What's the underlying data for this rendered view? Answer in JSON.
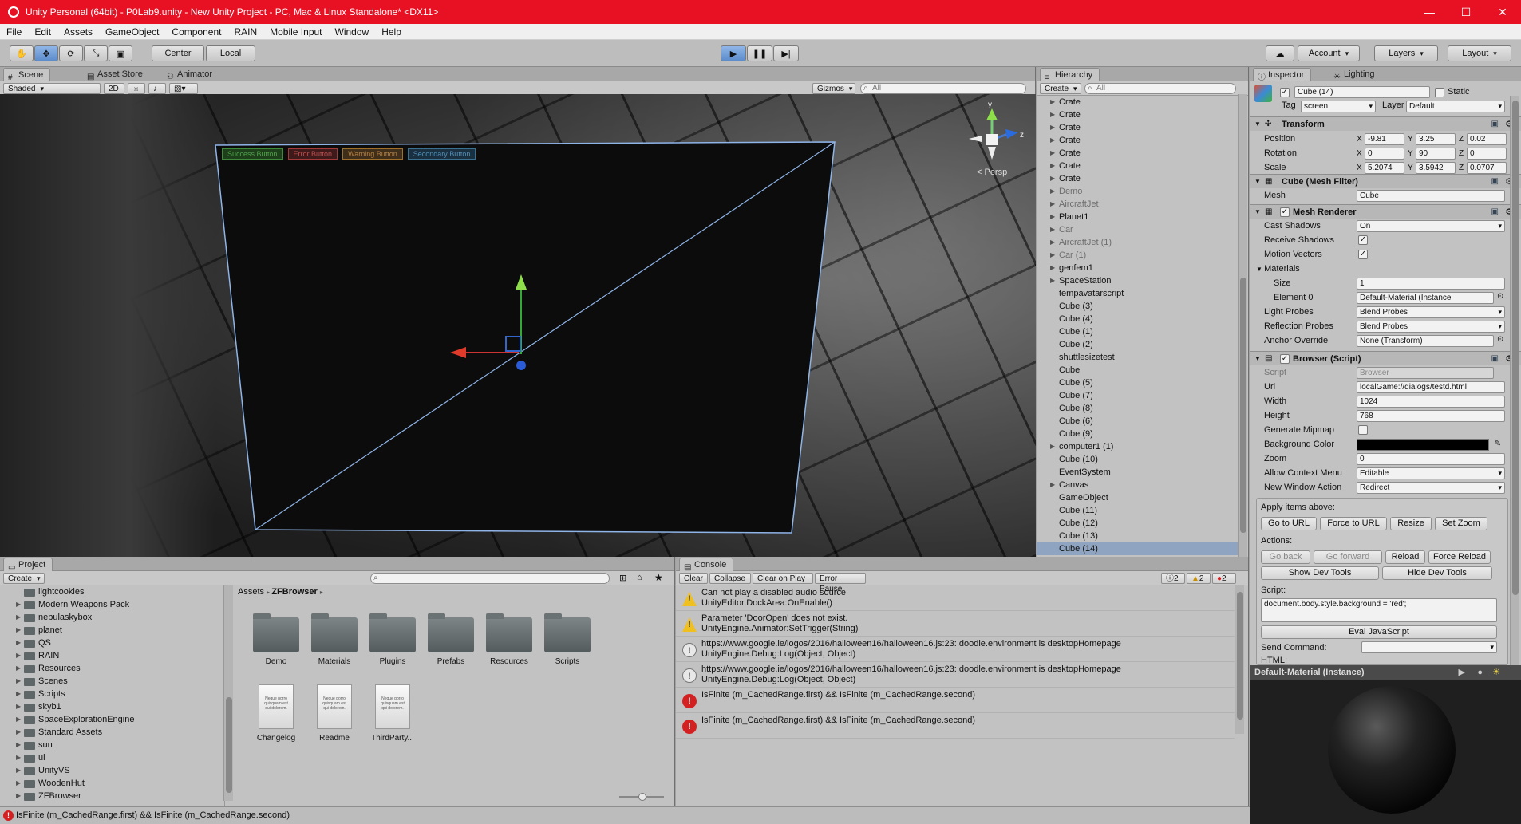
{
  "window": {
    "title": "Unity Personal (64bit) - P0Lab9.unity - New Unity Project - PC, Mac & Linux Standalone* <DX11>",
    "minimize": "—",
    "maximize": "☐",
    "close": "✕"
  },
  "menu": [
    "File",
    "Edit",
    "Assets",
    "GameObject",
    "Component",
    "RAIN",
    "Mobile Input",
    "Window",
    "Help"
  ],
  "toolbar": {
    "tools": [
      "✋",
      "✥",
      "⟳",
      "⤡",
      "▣"
    ],
    "center": "Center",
    "local": "Local",
    "play": "▶",
    "pause": "❚❚",
    "step": "▶|",
    "cloud": "☁",
    "account": "Account",
    "layers": "Layers",
    "layout": "Layout"
  },
  "scene": {
    "tabs": [
      "Scene",
      "Asset Store",
      "Animator"
    ],
    "shading": "Shaded",
    "mode2d": "2D",
    "gizmos": "Gizmos",
    "search_placeholder": "All",
    "buttons": [
      "Success Button",
      "Error Button",
      "Warning Button",
      "Secondary Button"
    ],
    "button_colors": [
      "#3f8a3a",
      "#a33a3a",
      "#a0702a",
      "#3a7090"
    ],
    "persp": "< Persp",
    "axis": {
      "y": "y",
      "z": "z"
    }
  },
  "hierarchy": {
    "tab": "Hierarchy",
    "create": "Create",
    "search_placeholder": "All",
    "items": [
      {
        "label": "Crate",
        "arrow": true,
        "dim": false
      },
      {
        "label": "Crate",
        "arrow": true,
        "dim": false
      },
      {
        "label": "Crate",
        "arrow": true,
        "dim": false
      },
      {
        "label": "Crate",
        "arrow": true,
        "dim": false
      },
      {
        "label": "Crate",
        "arrow": true,
        "dim": false
      },
      {
        "label": "Crate",
        "arrow": true,
        "dim": false
      },
      {
        "label": "Crate",
        "arrow": true,
        "dim": false
      },
      {
        "label": "Demo",
        "arrow": true,
        "dim": true
      },
      {
        "label": "AircraftJet",
        "arrow": true,
        "dim": true
      },
      {
        "label": "Planet1",
        "arrow": true,
        "dim": false
      },
      {
        "label": "Car",
        "arrow": true,
        "dim": true
      },
      {
        "label": "AircraftJet (1)",
        "arrow": true,
        "dim": true
      },
      {
        "label": "Car (1)",
        "arrow": true,
        "dim": true
      },
      {
        "label": "genfem1",
        "arrow": true,
        "dim": false
      },
      {
        "label": "SpaceStation",
        "arrow": true,
        "dim": false
      },
      {
        "label": "tempavatarscript",
        "arrow": false,
        "dim": false
      },
      {
        "label": "Cube (3)",
        "arrow": false,
        "dim": false
      },
      {
        "label": "Cube (4)",
        "arrow": false,
        "dim": false
      },
      {
        "label": "Cube (1)",
        "arrow": false,
        "dim": false
      },
      {
        "label": "Cube (2)",
        "arrow": false,
        "dim": false
      },
      {
        "label": "shuttlesizetest",
        "arrow": false,
        "dim": false
      },
      {
        "label": "Cube",
        "arrow": false,
        "dim": false
      },
      {
        "label": "Cube (5)",
        "arrow": false,
        "dim": false
      },
      {
        "label": "Cube (7)",
        "arrow": false,
        "dim": false
      },
      {
        "label": "Cube (8)",
        "arrow": false,
        "dim": false
      },
      {
        "label": "Cube (6)",
        "arrow": false,
        "dim": false
      },
      {
        "label": "Cube (9)",
        "arrow": false,
        "dim": false
      },
      {
        "label": "computer1 (1)",
        "arrow": true,
        "dim": false
      },
      {
        "label": "Cube (10)",
        "arrow": false,
        "dim": false
      },
      {
        "label": "EventSystem",
        "arrow": false,
        "dim": false
      },
      {
        "label": "Canvas",
        "arrow": true,
        "dim": false
      },
      {
        "label": "GameObject",
        "arrow": false,
        "dim": false
      },
      {
        "label": "Cube (11)",
        "arrow": false,
        "dim": false
      },
      {
        "label": "Cube (12)",
        "arrow": false,
        "dim": false
      },
      {
        "label": "Cube (13)",
        "arrow": false,
        "dim": false
      },
      {
        "label": "Cube (14)",
        "arrow": false,
        "dim": false,
        "selected": true
      }
    ]
  },
  "inspector": {
    "tabs": [
      "Inspector",
      "Lighting"
    ],
    "object_name": "Cube (14)",
    "static": "Static",
    "tag_label": "Tag",
    "tag": "screen",
    "layer_label": "Layer",
    "layer": "Default",
    "transform": {
      "title": "Transform",
      "position": {
        "label": "Position",
        "x": "-9.81",
        "y": "3.25",
        "z": "0.02"
      },
      "rotation": {
        "label": "Rotation",
        "x": "0",
        "y": "90",
        "z": "0"
      },
      "scale": {
        "label": "Scale",
        "x": "5.2074",
        "y": "3.5942",
        "z": "0.0707"
      }
    },
    "mesh_filter": {
      "title": "Cube (Mesh Filter)",
      "mesh_label": "Mesh",
      "mesh": "Cube"
    },
    "mesh_renderer": {
      "title": "Mesh Renderer",
      "cast_shadows_label": "Cast Shadows",
      "cast_shadows": "On",
      "receive_shadows_label": "Receive Shadows",
      "motion_vectors_label": "Motion Vectors",
      "materials_label": "Materials",
      "size_label": "Size",
      "size": "1",
      "element0_label": "Element 0",
      "element0": "Default-Material (Instance",
      "light_probes_label": "Light Probes",
      "light_probes": "Blend Probes",
      "reflection_probes_label": "Reflection Probes",
      "reflection_probes": "Blend Probes",
      "anchor_override_label": "Anchor Override",
      "anchor_override": "None (Transform)"
    },
    "browser": {
      "title": "Browser (Script)",
      "script_label": "Script",
      "script": "Browser",
      "url_label": "Url",
      "url": "localGame://dialogs/testd.html",
      "width_label": "Width",
      "width": "1024",
      "height_label": "Height",
      "height": "768",
      "mipmap_label": "Generate Mipmap",
      "bgcolor_label": "Background Color",
      "bgcolor": "#000000",
      "zoom_label": "Zoom",
      "zoom": "0",
      "context_label": "Allow Context Menu",
      "context": "Editable",
      "newwin_label": "New Window Action",
      "newwin": "Redirect"
    },
    "apply_label": "Apply items above:",
    "apply_buttons": [
      "Go to URL",
      "Force to URL",
      "Resize",
      "Set Zoom"
    ],
    "actions_label": "Actions:",
    "action_buttons": [
      "Go back",
      "Go forward",
      "Reload",
      "Force Reload"
    ],
    "devtools_buttons": [
      "Show Dev Tools",
      "Hide Dev Tools"
    ],
    "script_label2": "Script:",
    "script_text": "document.body.style.background = 'red';",
    "eval_button": "Eval JavaScript",
    "send_command_label": "Send Command:",
    "html_label": "HTML:"
  },
  "preview": {
    "title": "Default-Material (Instance)"
  },
  "project": {
    "tab": "Project",
    "create": "Create",
    "tree": [
      "lightcookies",
      "Modern Weapons Pack",
      "nebulaskybox",
      "planet",
      "QS",
      "RAIN",
      "Resources",
      "Scenes",
      "Scripts",
      "skyb1",
      "SpaceExplorationEngine",
      "Standard Assets",
      "sun",
      "ui",
      "UnityVS",
      "WoodenHut",
      "ZFBrowser"
    ],
    "breadcrumb": [
      "Assets",
      "ZFBrowser"
    ],
    "folders": [
      "Demo",
      "Materials",
      "Plugins",
      "Prefabs",
      "Resources",
      "Scripts"
    ],
    "files": [
      "Changelog",
      "Readme",
      "ThirdParty..."
    ],
    "doc_preview": "Neque porro quisquam est qui dolorem."
  },
  "console": {
    "tab": "Console",
    "buttons": [
      "Clear",
      "Collapse",
      "Clear on Play",
      "Error Pause"
    ],
    "counts": {
      "info": "2",
      "warn": "2",
      "error": "2"
    },
    "lines": [
      {
        "type": "warn",
        "t1": "Can not play a disabled audio source",
        "t2": "UnityEditor.DockArea:OnEnable()"
      },
      {
        "type": "warn",
        "t1": "Parameter 'DoorOpen' does not exist.",
        "t2": "UnityEngine.Animator:SetTrigger(String)"
      },
      {
        "type": "info",
        "t1": "https://www.google.ie/logos/2016/halloween16/halloween16.js:23: doodle.environment is desktopHomepage",
        "t2": "UnityEngine.Debug:Log(Object, Object)"
      },
      {
        "type": "info",
        "t1": "https://www.google.ie/logos/2016/halloween16/halloween16.js:23: doodle.environment is desktopHomepage",
        "t2": "UnityEngine.Debug:Log(Object, Object)"
      },
      {
        "type": "err",
        "t1": "IsFinite (m_CachedRange.first) && IsFinite (m_CachedRange.second)",
        "t2": ""
      },
      {
        "type": "err",
        "t1": "IsFinite (m_CachedRange.first) && IsFinite (m_CachedRange.second)",
        "t2": ""
      }
    ]
  },
  "status": {
    "text": "IsFinite (m_CachedRange.first) && IsFinite (m_CachedRange.second)"
  }
}
